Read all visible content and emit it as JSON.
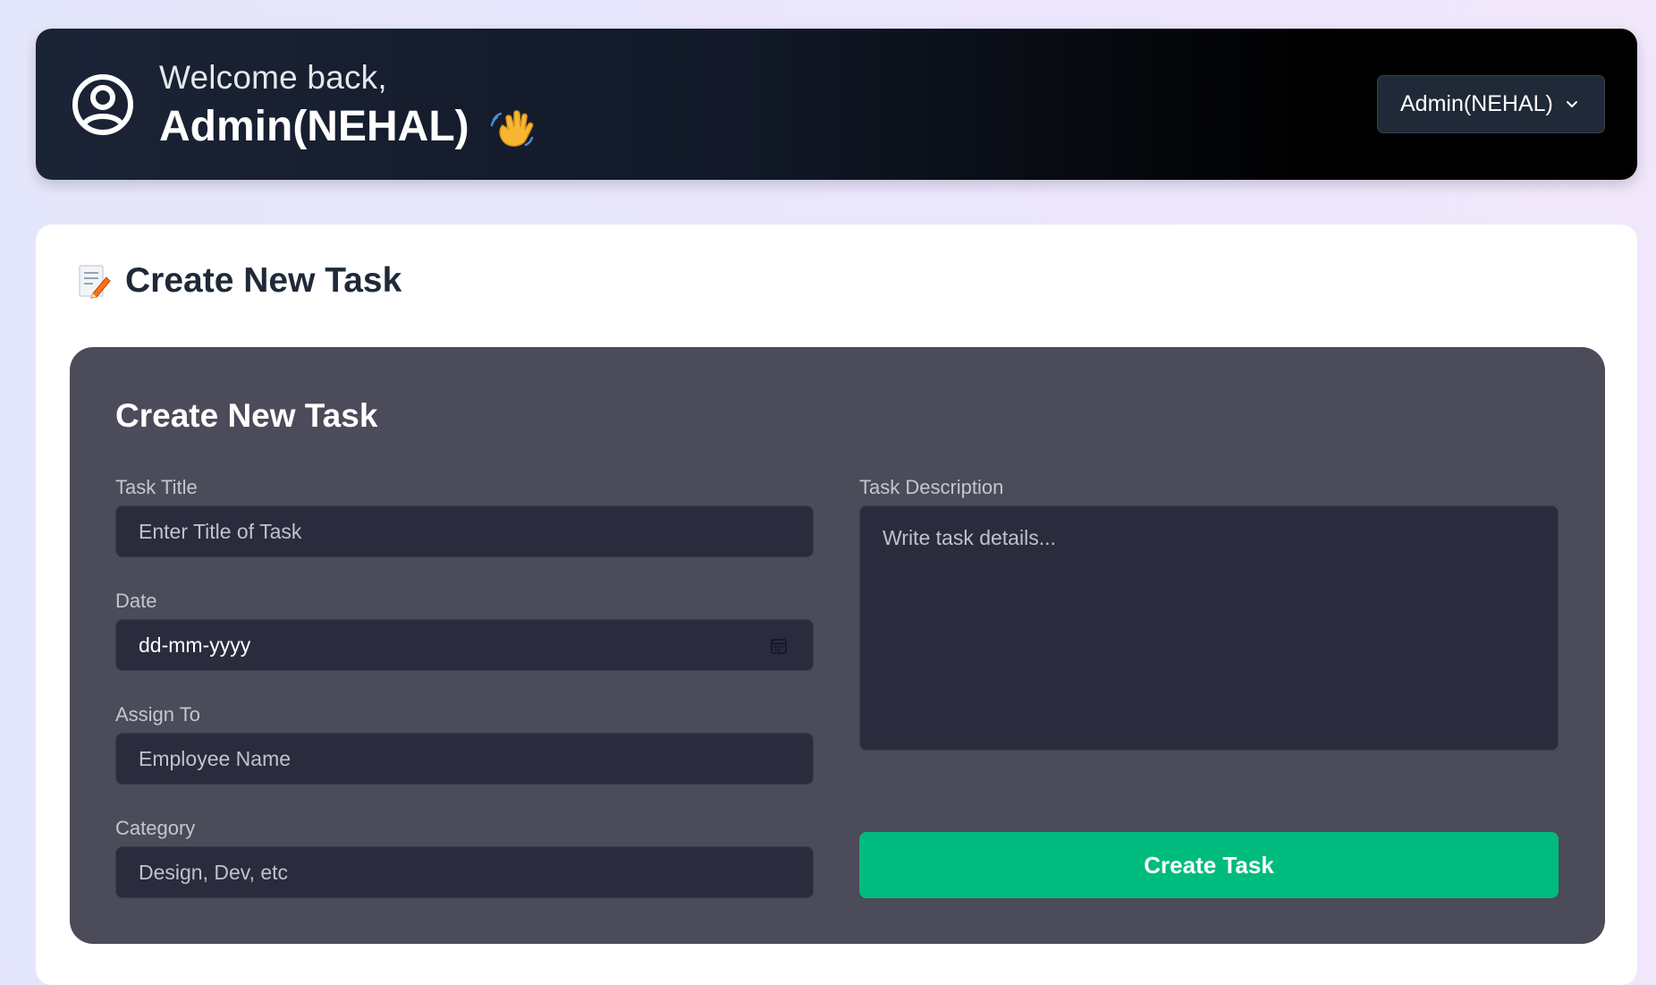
{
  "header": {
    "greeting": "Welcome back,",
    "admin_name": "Admin(NEHAL)",
    "user_menu_label": "Admin(NEHAL)",
    "icons": {
      "user": "user-circle-icon",
      "wave": "waving-hand-icon",
      "dropdown": "chevron-down-icon"
    }
  },
  "page": {
    "title": "Create New Task",
    "title_icon": "memo-icon"
  },
  "form": {
    "title": "Create New Task",
    "task_title": {
      "label": "Task Title",
      "placeholder": "Enter Title of Task"
    },
    "date": {
      "label": "Date",
      "placeholder": "dd-mm-yyyy",
      "icon": "calendar-icon"
    },
    "assign_to": {
      "label": "Assign To",
      "placeholder": "Employee Name"
    },
    "category": {
      "label": "Category",
      "placeholder": "Design, Dev, etc"
    },
    "description": {
      "label": "Task Description",
      "placeholder": "Write task details..."
    },
    "submit_label": "Create Task"
  },
  "colors": {
    "accent": "#00bb7e",
    "panel": "#4b4b5a",
    "input": "#2a2b3d",
    "header_start": "#1b2436",
    "header_end": "#000000"
  }
}
